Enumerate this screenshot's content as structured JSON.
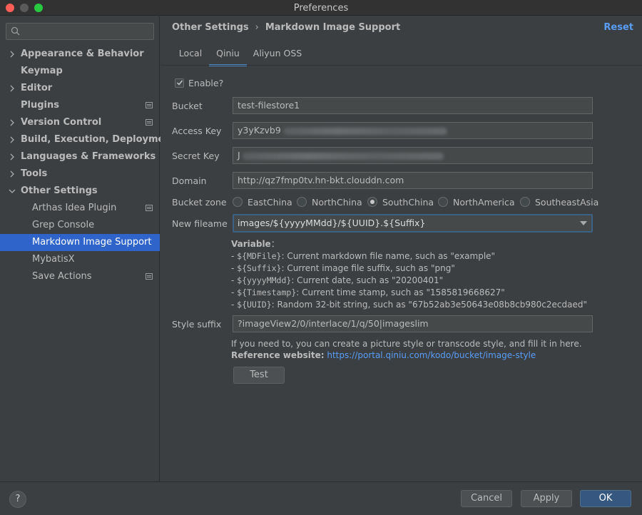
{
  "window": {
    "title": "Preferences"
  },
  "sidebar": {
    "search_placeholder": "",
    "items": [
      {
        "label": "Appearance & Behavior"
      },
      {
        "label": "Keymap"
      },
      {
        "label": "Editor"
      },
      {
        "label": "Plugins"
      },
      {
        "label": "Version Control"
      },
      {
        "label": "Build, Execution, Deployment"
      },
      {
        "label": "Languages & Frameworks"
      },
      {
        "label": "Tools"
      },
      {
        "label": "Other Settings"
      },
      {
        "label": "Arthas Idea Plugin"
      },
      {
        "label": "Grep Console"
      },
      {
        "label": "Markdown Image Support"
      },
      {
        "label": "MybatisX"
      },
      {
        "label": "Save Actions"
      }
    ]
  },
  "header": {
    "breadcrumb_parent": "Other Settings",
    "breadcrumb_separator": "›",
    "breadcrumb_current": "Markdown Image Support",
    "reset_label": "Reset"
  },
  "tabs": [
    {
      "label": "Local"
    },
    {
      "label": "Qiniu"
    },
    {
      "label": "Aliyun OSS"
    }
  ],
  "form": {
    "enable_label": "Enable?",
    "enable_checked": true,
    "bucket_label": "Bucket",
    "bucket_value": "test-filestore1",
    "access_key_label": "Access Key",
    "access_key_value": "y3yKzvb9",
    "secret_key_label": "Secret Key",
    "secret_key_value": "J",
    "domain_label": "Domain",
    "domain_value": "http://qz7fmp0tv.hn-bkt.clouddn.com",
    "bucket_zone_label": "Bucket zone",
    "zones": [
      "EastChina",
      "NorthChina",
      "SouthChina",
      "NorthAmerica",
      "SoutheastAsia"
    ],
    "selected_zone": "SouthChina",
    "new_filename_label": "New fileame",
    "new_filename_value": "images/${yyyyMMdd}/${UUID}.${Suffix}",
    "style_suffix_label": "Style suffix",
    "style_suffix_value": "?imageView2/0/interlace/1/q/50|imageslim",
    "test_label": "Test"
  },
  "variables": {
    "heading": "Variable",
    "heading_suffix": "：",
    "rows": [
      {
        "prefix": "- ",
        "name": "${MDFile}",
        "desc": ": Current markdown file name, such as \"example\""
      },
      {
        "prefix": "- ",
        "name": "${Suffix}",
        "desc": ": Current image file suffix, such as \"png\""
      },
      {
        "prefix": "- ",
        "name": "${yyyyMMdd}",
        "desc": ": Current date, such as \"20200401\""
      },
      {
        "prefix": "- ",
        "name": "${Timestamp}",
        "desc": ": Current time stamp, such as \"1585819668627\""
      },
      {
        "prefix": "- ",
        "name": "${UUID}",
        "desc": ": Random 32-bit string, such as \"67b52ab3e50643e08b8cb980c2ecdaed\""
      }
    ]
  },
  "hint": {
    "line1": "If you need to, you can create a picture style or transcode style, and fill it in here.",
    "ref_label": "Reference website:",
    "ref_link": "https://portal.qiniu.com/kodo/bucket/image-style"
  },
  "footer": {
    "help_label": "?",
    "cancel_label": "Cancel",
    "apply_label": "Apply",
    "ok_label": "OK"
  },
  "colors": {
    "accent": "#2f65ca",
    "link": "#589df6",
    "background": "#3c3f41"
  }
}
